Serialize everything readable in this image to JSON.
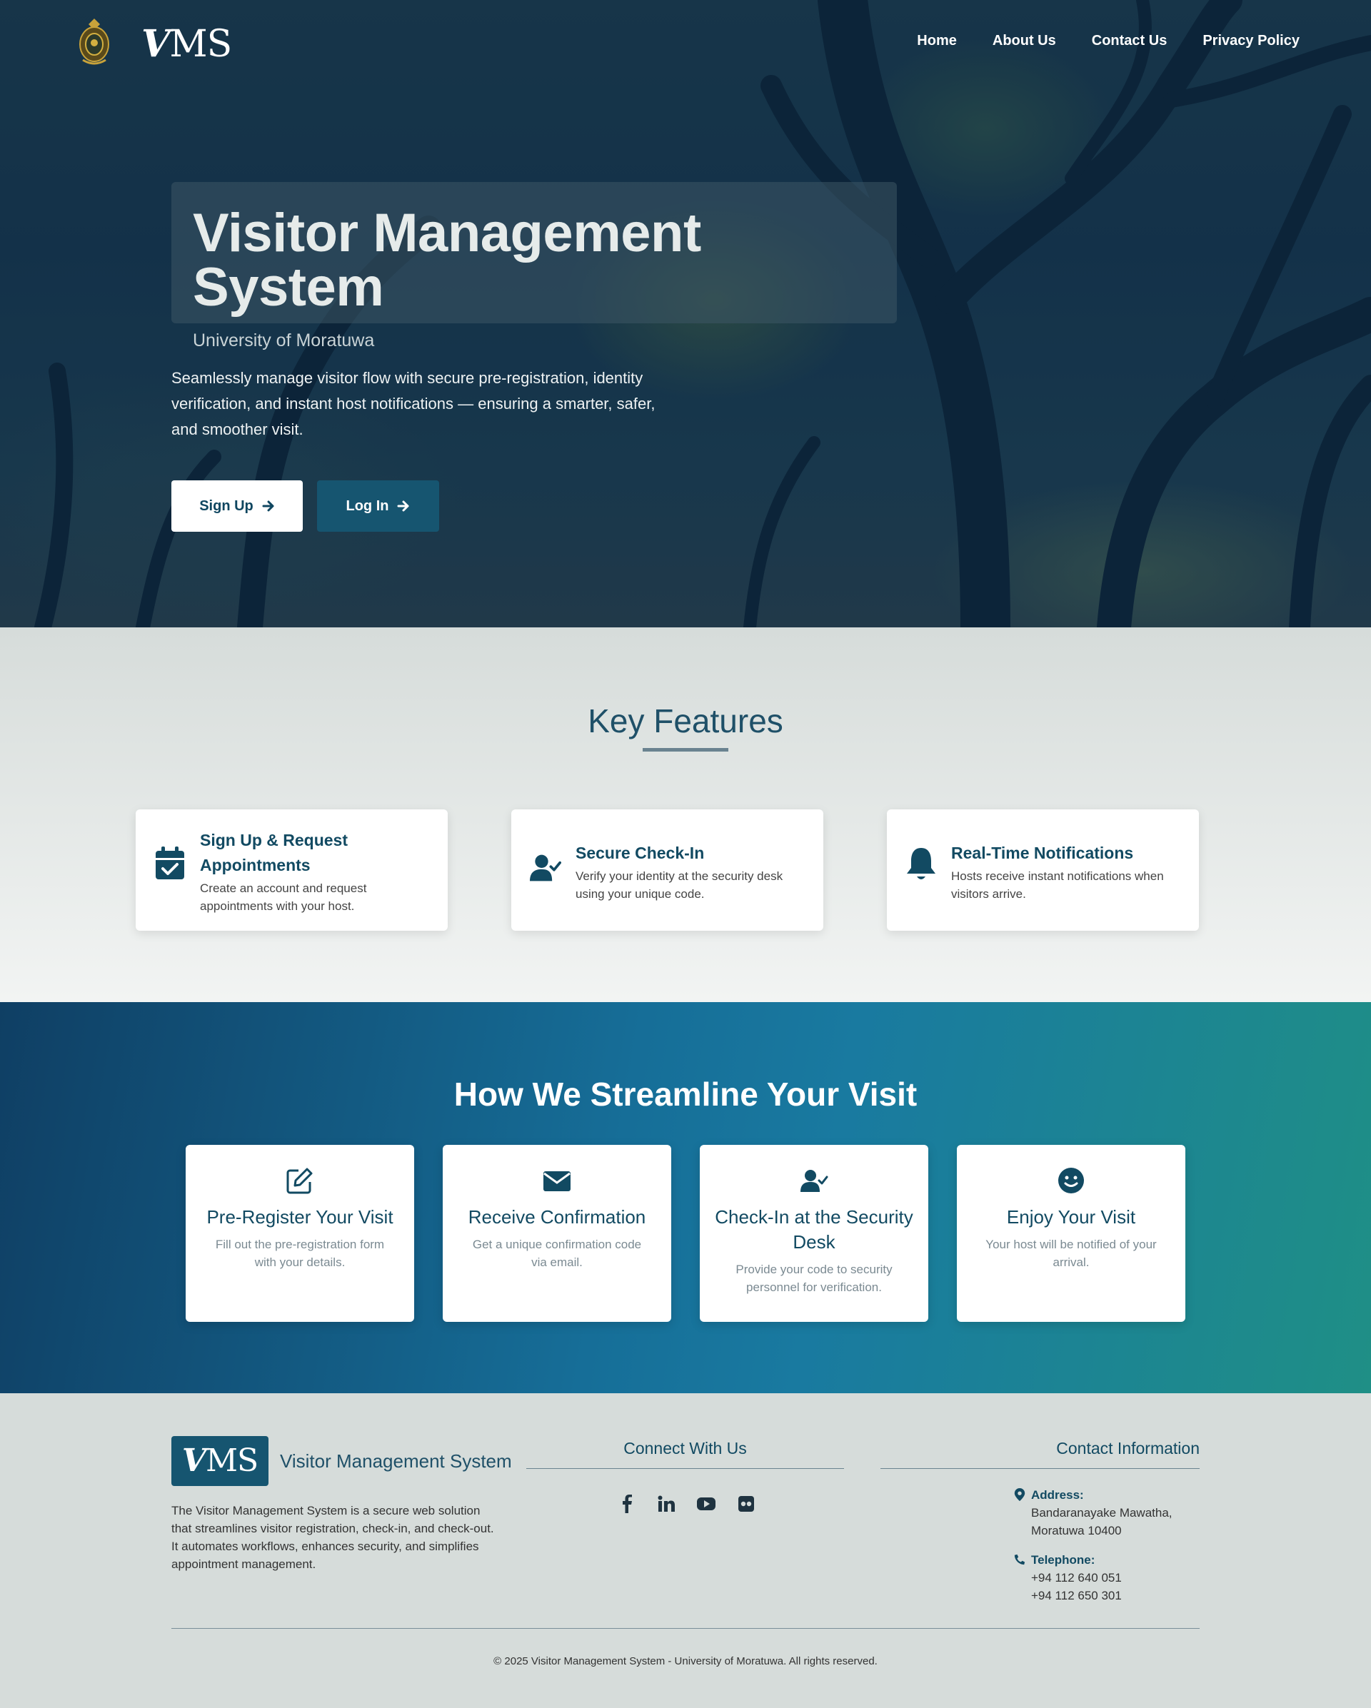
{
  "nav": {
    "logo_text_v": "V",
    "logo_text_rest": "MS",
    "links": [
      "Home",
      "About Us",
      "Contact Us",
      "Privacy Policy"
    ]
  },
  "hero": {
    "title": "Visitor Management System",
    "subtitle": "University of Moratuwa",
    "description": "Seamlessly manage visitor flow with secure pre-registration, identity verification, and instant host notifications — ensuring a smarter, safer, and smoother visit.",
    "signup_label": "Sign Up",
    "login_label": "Log In"
  },
  "features": {
    "heading": "Key Features",
    "cards": [
      {
        "title": "Sign Up & Request Appointments",
        "desc": "Create an account and request appointments with your host.",
        "icon": "calendar-check-icon"
      },
      {
        "title": "Secure Check-In",
        "desc": "Verify your identity at the security desk using your unique code.",
        "icon": "user-check-icon"
      },
      {
        "title": "Real-Time Notifications",
        "desc": "Hosts receive instant notifications when visitors arrive.",
        "icon": "bell-icon"
      }
    ]
  },
  "streamline": {
    "heading": "How We Streamline Your Visit",
    "cards": [
      {
        "title": "Pre-Register Your Visit",
        "desc": "Fill out the pre-registration form with your details.",
        "icon": "edit-icon"
      },
      {
        "title": "Receive Confirmation",
        "desc": "Get a unique confirmation code via email.",
        "icon": "envelope-icon"
      },
      {
        "title": "Check-In at the Security Desk",
        "desc": "Provide your code to security personnel for verification.",
        "icon": "user-check-icon"
      },
      {
        "title": "Enjoy Your Visit",
        "desc": "Your host will be notified of your arrival.",
        "icon": "smile-icon"
      }
    ]
  },
  "footer": {
    "logo_v": "V",
    "logo_rest": "MS",
    "brand": "Visitor Management System",
    "about": "The Visitor Management System is a secure web solution that streamlines visitor registration, check-in, and check-out. It automates workflows, enhances security, and simplifies appointment management.",
    "connect_heading": "Connect With Us",
    "socials": [
      "facebook-icon",
      "linkedin-icon",
      "youtube-icon",
      "flickr-icon"
    ],
    "contact_heading": "Contact Information",
    "address_label": "Address:",
    "address_line1": "Bandaranayake Mawatha,",
    "address_line2": "Moratuwa 10400",
    "telephone_label": "Telephone:",
    "phone1": "+94 112 640 051",
    "phone2": "+94 112 650 301",
    "copyright": "© 2025 Visitor Management System - University of Moratuwa. All rights reserved."
  },
  "colors": {
    "brand": "#124a62",
    "accent": "#165570",
    "gradient_start": "#0f3f64",
    "gradient_end": "#1f8f86"
  }
}
